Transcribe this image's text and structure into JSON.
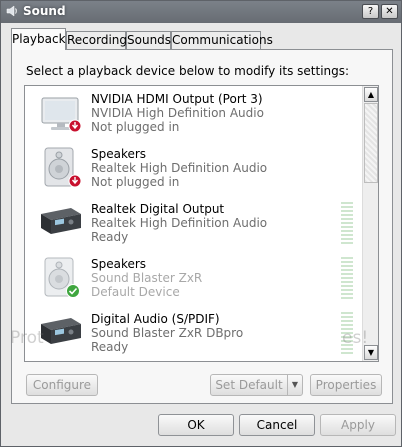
{
  "window": {
    "title": "Sound",
    "help_button": "?",
    "close_button": "✕"
  },
  "tabs": [
    {
      "label": "Playback",
      "active": true
    },
    {
      "label": "Recording",
      "active": false
    },
    {
      "label": "Sounds",
      "active": false
    },
    {
      "label": "Communications",
      "active": false
    }
  ],
  "instruction": "Select a playback device below to modify its settings:",
  "devices": [
    {
      "name": "NVIDIA HDMI Output (Port 3)",
      "driver": "NVIDIA High Definition Audio",
      "status": "Not plugged in",
      "icon": "monitor-icon",
      "badge": "unplugged-badge-icon"
    },
    {
      "name": "Speakers",
      "driver": "Realtek High Definition Audio",
      "status": "Not plugged in",
      "icon": "speaker-icon",
      "badge": "unplugged-badge-icon"
    },
    {
      "name": "Realtek Digital Output",
      "driver": "Realtek High Definition Audio",
      "status": "Ready",
      "icon": "digital-output-icon"
    },
    {
      "name": "Speakers",
      "driver": "Sound Blaster ZxR",
      "status": "Default Device",
      "icon": "speaker-icon",
      "badge": "default-check-badge-icon"
    },
    {
      "name": "Digital Audio (S/PDIF)",
      "driver": "Sound Blaster ZxR DBpro",
      "status": "Ready",
      "icon": "digital-output-icon"
    }
  ],
  "buttons": {
    "configure": "Configure",
    "set_default": "Set Default",
    "properties": "Properties",
    "ok": "OK",
    "cancel": "Cancel",
    "apply": "Apply"
  },
  "scrollbar": {
    "up": "▲",
    "down": "▼"
  },
  "watermark": {
    "left": "Prot",
    "right": "es!"
  },
  "colors": {
    "titlebar": "#6f747b",
    "accent_red": "#c8102e",
    "accent_green": "#3fa63f"
  }
}
